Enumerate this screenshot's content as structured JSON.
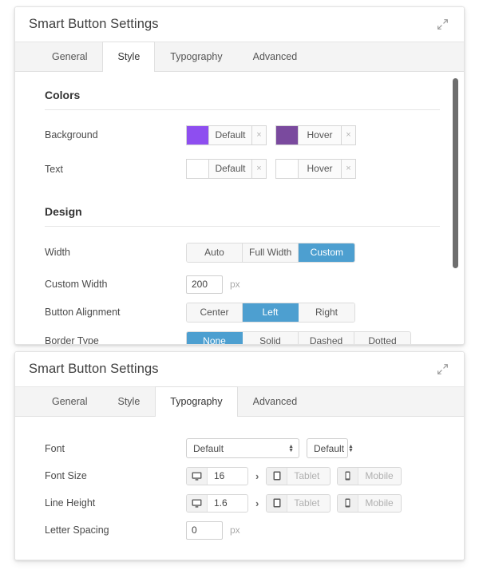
{
  "theme": {
    "accent_blue": "#4d9fd0",
    "page_background": "#ffffff",
    "panel_background": "#ffffff",
    "tabbar_background": "#f4f4f4",
    "border": "#e0e0e0",
    "scrollbar_thumb": "#6e6e6e"
  },
  "panel_style": {
    "title": "Smart Button Settings",
    "expand_icon": "expand-diagonal-arrows-icon",
    "tabs": [
      {
        "label": "General",
        "active": false
      },
      {
        "label": "Style",
        "active": true
      },
      {
        "label": "Typography",
        "active": false
      },
      {
        "label": "Advanced",
        "active": false
      }
    ],
    "sections": {
      "colors": {
        "heading": "Colors",
        "rows": [
          {
            "label": "Background",
            "pickers": [
              {
                "state_label": "Default",
                "swatch_color": "#8e4ef0",
                "clear_label": "×"
              },
              {
                "state_label": "Hover",
                "swatch_color": "#7a4a9e",
                "clear_label": "×"
              }
            ]
          },
          {
            "label": "Text",
            "pickers": [
              {
                "state_label": "Default",
                "swatch_color": "#ffffff",
                "clear_label": "×"
              },
              {
                "state_label": "Hover",
                "swatch_color": "#ffffff",
                "clear_label": "×"
              }
            ]
          }
        ]
      },
      "design": {
        "heading": "Design",
        "width": {
          "label": "Width",
          "options": [
            {
              "label": "Auto",
              "active": false
            },
            {
              "label": "Full Width",
              "active": false
            },
            {
              "label": "Custom",
              "active": true
            }
          ]
        },
        "custom_width": {
          "label": "Custom Width",
          "value": "200",
          "unit": "px"
        },
        "button_alignment": {
          "label": "Button Alignment",
          "options": [
            {
              "label": "Center",
              "active": false
            },
            {
              "label": "Left",
              "active": true
            },
            {
              "label": "Right",
              "active": false
            }
          ]
        },
        "border_type": {
          "label": "Border Type",
          "options": [
            {
              "label": "None",
              "active": true
            },
            {
              "label": "Solid",
              "active": false
            },
            {
              "label": "Dashed",
              "active": false
            },
            {
              "label": "Dotted",
              "active": false
            }
          ]
        }
      }
    }
  },
  "panel_typography": {
    "title": "Smart Button Settings",
    "expand_icon": "expand-diagonal-arrows-icon",
    "tabs": [
      {
        "label": "General",
        "active": false
      },
      {
        "label": "Style",
        "active": false
      },
      {
        "label": "Typography",
        "active": true
      },
      {
        "label": "Advanced",
        "active": false
      }
    ],
    "rows": {
      "font": {
        "label": "Font",
        "family_value": "Default",
        "weight_value": "Default"
      },
      "font_size": {
        "label": "Font Size",
        "separator": "›",
        "devices": [
          {
            "icon": "desktop-icon",
            "value": "16",
            "is_placeholder": false
          },
          {
            "icon": "tablet-icon",
            "value": "Tablet",
            "is_placeholder": true
          },
          {
            "icon": "mobile-icon",
            "value": "Mobile",
            "is_placeholder": true
          }
        ]
      },
      "line_height": {
        "label": "Line Height",
        "separator": "›",
        "devices": [
          {
            "icon": "desktop-icon",
            "value": "1.6",
            "is_placeholder": false
          },
          {
            "icon": "tablet-icon",
            "value": "Tablet",
            "is_placeholder": true
          },
          {
            "icon": "mobile-icon",
            "value": "Mobile",
            "is_placeholder": true
          }
        ]
      },
      "letter_spacing": {
        "label": "Letter Spacing",
        "value": "0",
        "unit": "px"
      }
    }
  }
}
